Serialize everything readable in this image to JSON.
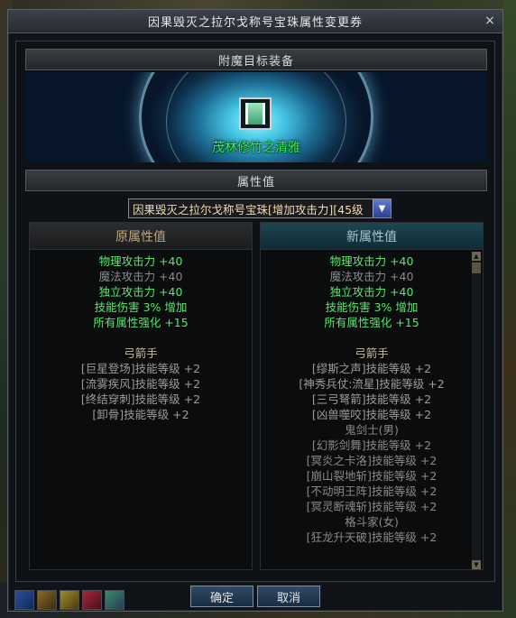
{
  "window": {
    "title": "因果毁灭之拉尔戈称号宝珠属性变更券",
    "close_glyph": "×"
  },
  "target_section": {
    "header": "附魔目标装备",
    "item_name": "茂林修竹之清雅",
    "item_icon": "bamboo-icon"
  },
  "attr_section": {
    "header": "属性值",
    "select_value": "因果毁灭之拉尔戈称号宝珠[增加攻击力][45级",
    "select_arrow": "▼"
  },
  "original": {
    "header": "原属性值",
    "rows": [
      {
        "text": "物理攻击力 +40",
        "color": "green"
      },
      {
        "text": "魔法攻击力 +40",
        "color": "gray"
      },
      {
        "text": "独立攻击力 +40",
        "color": "green"
      },
      {
        "text": "技能伤害 3% 增加",
        "color": "green"
      },
      {
        "text": "所有属性强化 +15",
        "color": "green"
      },
      {
        "text": "",
        "color": "spacer"
      },
      {
        "text": "弓箭手",
        "color": "tan"
      },
      {
        "text": "[巨星登场]技能等级 +2",
        "color": "lgray"
      },
      {
        "text": "[流雾疾风]技能等级 +2",
        "color": "lgray"
      },
      {
        "text": "[终结穿刺]技能等级 +2",
        "color": "lgray"
      },
      {
        "text": "[卸骨]技能等级 +2",
        "color": "lgray"
      }
    ]
  },
  "new": {
    "header": "新属性值",
    "rows": [
      {
        "text": "物理攻击力 +40",
        "color": "green"
      },
      {
        "text": "魔法攻击力 +40",
        "color": "gray"
      },
      {
        "text": "独立攻击力 +40",
        "color": "green"
      },
      {
        "text": "技能伤害 3% 增加",
        "color": "green"
      },
      {
        "text": "所有属性强化 +15",
        "color": "green"
      },
      {
        "text": "",
        "color": "spacer"
      },
      {
        "text": "弓箭手",
        "color": "tan"
      },
      {
        "text": "[缪斯之声]技能等级 +2",
        "color": "lgray"
      },
      {
        "text": "[神秀兵仗:流星]技能等级 +2",
        "color": "lgray"
      },
      {
        "text": "[三弓弩箭]技能等级 +2",
        "color": "lgray"
      },
      {
        "text": "[凶兽噬咬]技能等级 +2",
        "color": "lgray"
      },
      {
        "text": "鬼剑士(男)",
        "color": "gray"
      },
      {
        "text": "[幻影剑舞]技能等级 +2",
        "color": "gray"
      },
      {
        "text": "[冥炎之卡洛]技能等级 +2",
        "color": "gray"
      },
      {
        "text": "[崩山裂地斩]技能等级 +2",
        "color": "gray"
      },
      {
        "text": "[不动明王阵]技能等级 +2",
        "color": "gray"
      },
      {
        "text": "[冥灵断魂斩]技能等级 +2",
        "color": "gray"
      },
      {
        "text": "格斗家(女)",
        "color": "gray"
      },
      {
        "text": "[狂龙升天破]技能等级 +2",
        "color": "gray"
      }
    ]
  },
  "buttons": {
    "confirm": "确定",
    "cancel": "取消"
  },
  "hotbar_icons": [
    "skill-slot-icon",
    "skill-slot-icon",
    "skill-slot-icon",
    "heart-icon",
    "potion-icon"
  ]
}
